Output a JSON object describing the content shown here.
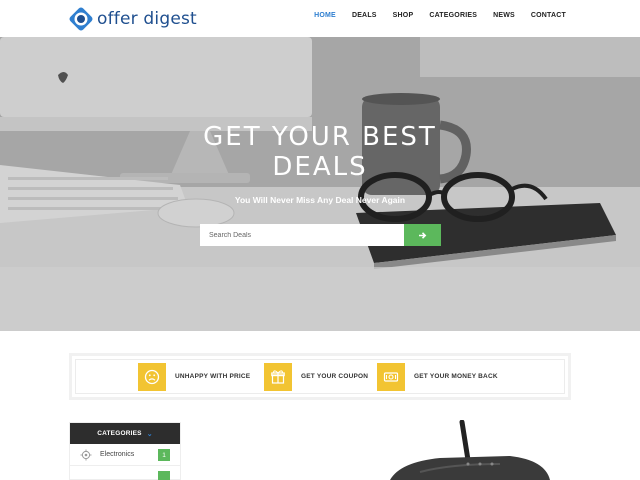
{
  "header": {
    "logo_text": "offer digest",
    "nav": [
      {
        "label": "HOME",
        "active": true
      },
      {
        "label": "DEALS"
      },
      {
        "label": "SHOP"
      },
      {
        "label": "CATEGORIES"
      },
      {
        "label": "NEWS"
      },
      {
        "label": "CONTACT"
      }
    ]
  },
  "hero": {
    "title_line1": "GET YOUR BEST",
    "title_line2": "DEALS",
    "subtitle": "You Will Never Miss Any Deal Never Again",
    "search_placeholder": "Search Deals",
    "search_button_icon": "arrow-right-icon"
  },
  "features": [
    {
      "label": "UNHAPPY WITH PRICE",
      "icon": "sad-face-icon"
    },
    {
      "label": "GET YOUR COUPON",
      "icon": "gift-icon"
    },
    {
      "label": "GET YOUR MONEY BACK",
      "icon": "cash-icon"
    }
  ],
  "categories": {
    "title": "CATEGORIES",
    "items": [
      {
        "label": "Electronics",
        "count": "1",
        "icon": "chip-icon"
      }
    ]
  },
  "colors": {
    "accent_blue": "#2f7fd0",
    "green": "#5cb85c",
    "yellow": "#f2c432",
    "dark": "#2d2d2d"
  }
}
